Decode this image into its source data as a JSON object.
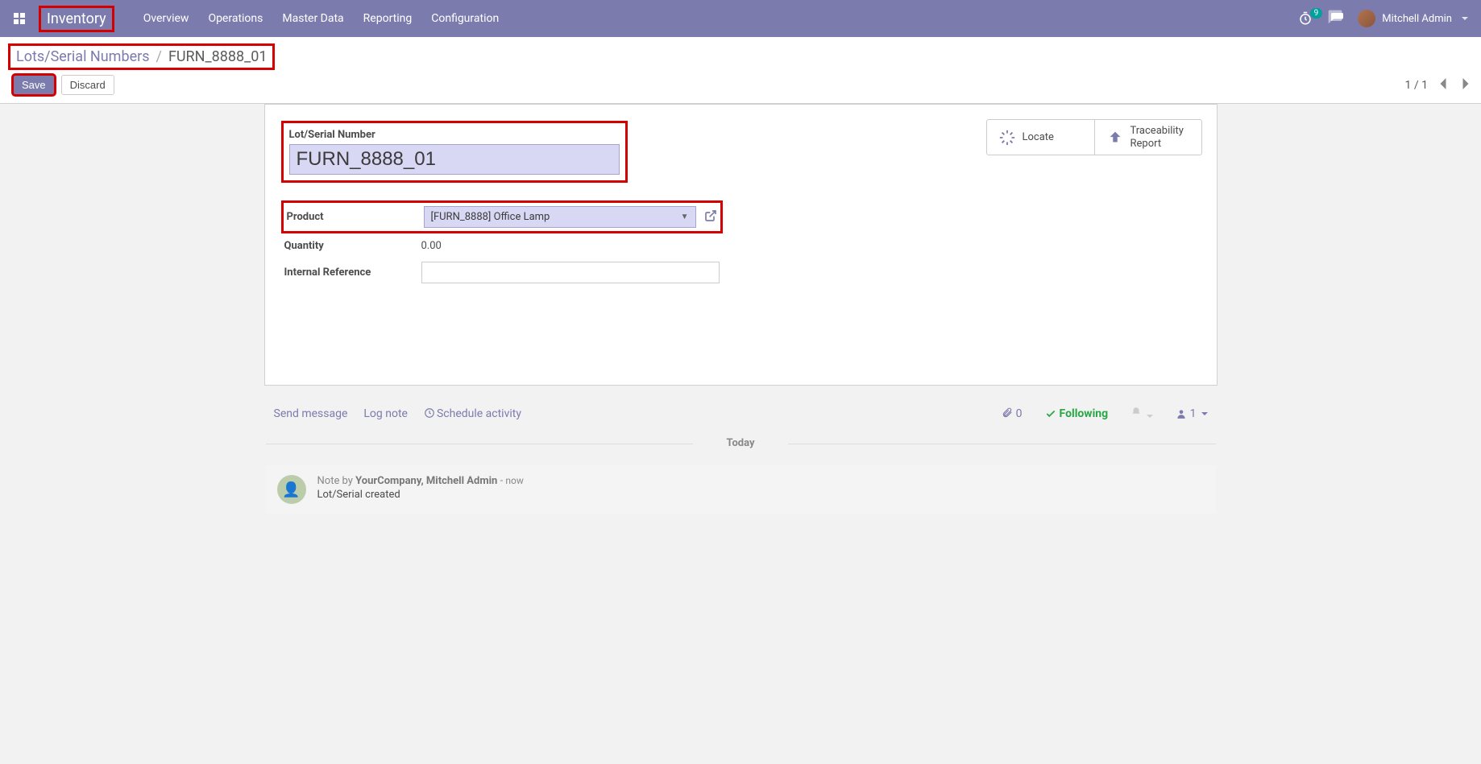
{
  "navbar": {
    "brand": "Inventory",
    "items": [
      "Overview",
      "Operations",
      "Master Data",
      "Reporting",
      "Configuration"
    ],
    "timer_badge": "9",
    "user_name": "Mitchell Admin"
  },
  "breadcrumb": {
    "parent": "Lots/Serial Numbers",
    "sep": "/",
    "current": "FURN_8888_01"
  },
  "buttons": {
    "save": "Save",
    "discard": "Discard"
  },
  "pager": {
    "text": "1 / 1"
  },
  "statbuttons": {
    "locate": "Locate",
    "trace_l1": "Traceability",
    "trace_l2": "Report"
  },
  "form": {
    "title_label": "Lot/Serial Number",
    "title_value": "FURN_8888_01",
    "product_label": "Product",
    "product_value": "[FURN_8888] Office Lamp",
    "quantity_label": "Quantity",
    "quantity_value": "0.00",
    "ref_label": "Internal Reference",
    "ref_value": ""
  },
  "chatter": {
    "send": "Send message",
    "log": "Log note",
    "schedule": "Schedule activity",
    "attach_count": "0",
    "following": "Following",
    "followers_count": "1",
    "date_divider": "Today",
    "note_prefix": "Note by ",
    "note_author": "YourCompany, Mitchell Admin",
    "note_time_sep": " - ",
    "note_time": "now",
    "note_body": "Lot/Serial created"
  }
}
